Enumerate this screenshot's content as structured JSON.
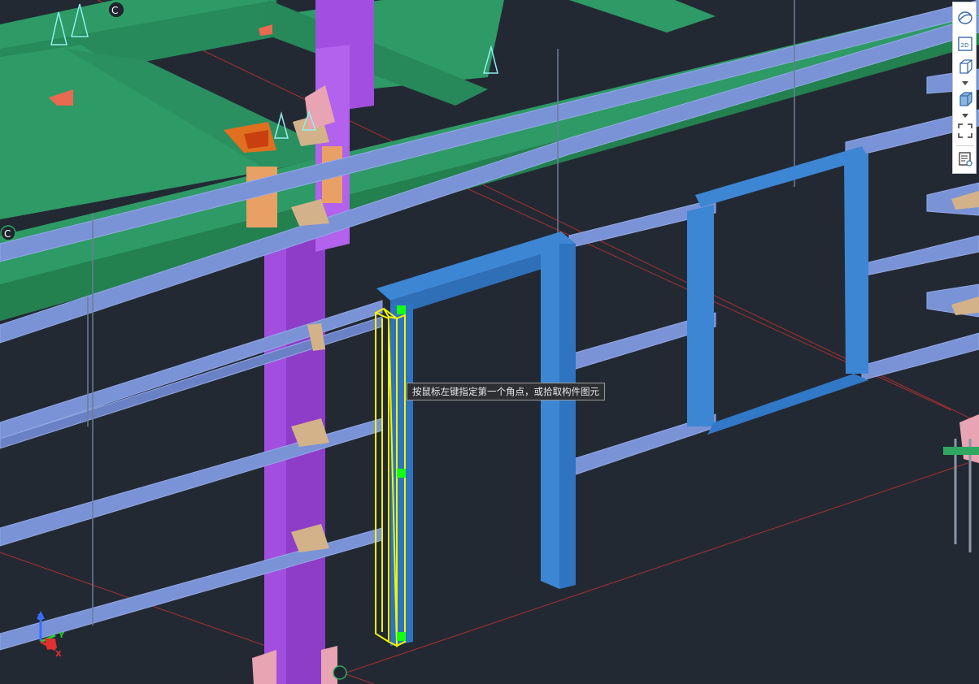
{
  "tooltip": {
    "text": "按鼠标左键指定第一个角点，或拾取构件图元"
  },
  "toolbar": {
    "items": [
      {
        "icon": "orbit-icon"
      },
      {
        "icon": "2d-view-icon",
        "label": "2D"
      },
      {
        "icon": "3d-box-view-icon"
      },
      {
        "icon": "shaded-box-icon"
      },
      {
        "icon": "fit-extents-icon"
      },
      {
        "icon": "layer-properties-icon"
      }
    ]
  },
  "grid_labels": {
    "top": "C",
    "left": "C"
  },
  "axis": {
    "z": "Z",
    "y": "Y",
    "x": "X"
  },
  "colors": {
    "background": "#232933",
    "green_beam": "#2e9a66",
    "purple_column": "#a24fdf",
    "light_blue_beam": "#7a93d6",
    "blue_frame": "#3d86d3",
    "selection": "#f5f500",
    "grip": "#14ff14"
  }
}
